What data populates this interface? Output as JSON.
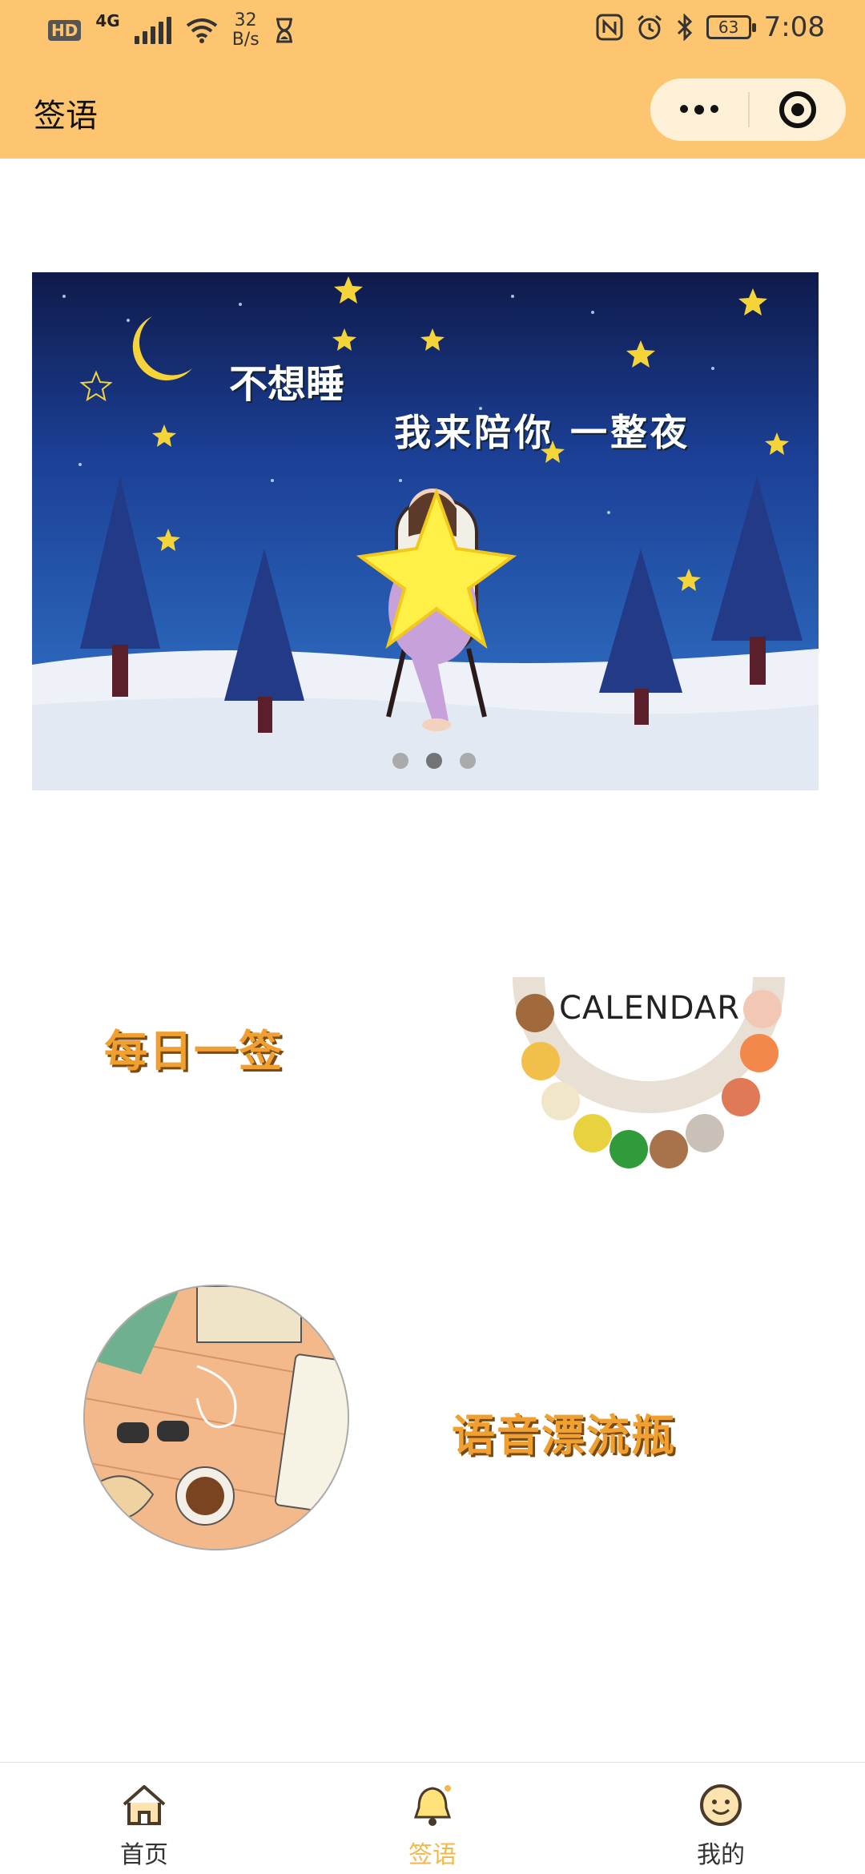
{
  "status_bar": {
    "hd": "HD",
    "network": "4G",
    "speed_value": "32",
    "speed_unit": "B/s",
    "battery": "63",
    "time": "7:08"
  },
  "header": {
    "title": "签语",
    "background_color": "#FDC570"
  },
  "banner": {
    "line1": "不想睡",
    "line2": "我来陪你 一整夜",
    "dot_count": 3,
    "active_dot_index": 1
  },
  "features": {
    "daily": {
      "label": "每日一签"
    },
    "calendar_art_text": "CALENDAR",
    "bottle": {
      "label": "语音漂流瓶"
    }
  },
  "tabbar": {
    "items": [
      {
        "label": "首页",
        "icon": "home-icon",
        "active": false
      },
      {
        "label": "签语",
        "icon": "bell-icon",
        "active": true
      },
      {
        "label": "我的",
        "icon": "smiley-icon",
        "active": false
      }
    ],
    "active_color": "#F2B84B"
  }
}
